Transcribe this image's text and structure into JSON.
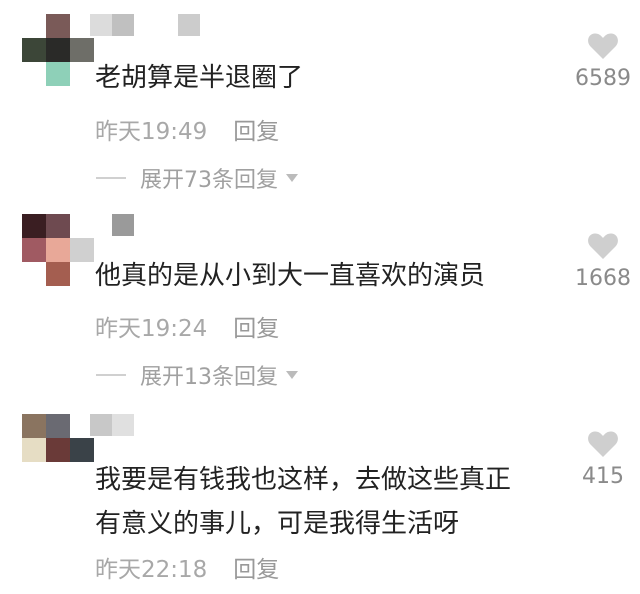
{
  "comments": [
    {
      "text_lines": [
        "老胡算是半退圈了"
      ],
      "time": "昨天19:49",
      "reply_label": "回复",
      "expand_label": "展开73条回复",
      "likes": "6589",
      "avatar_pixels": [
        "#ffffff",
        "#7a5a58",
        "#ffffff",
        "#ffffff",
        "#3c4638",
        "#2a2a28",
        "#6e6e68",
        "#ffffff",
        "#ffffff",
        "#8ed0b8",
        "#ffffff",
        "#ffffff"
      ],
      "name_pixels": [
        "#dcdcdc",
        "#c0c0c0",
        "#ffffff",
        "#ffffff",
        "#cccccc"
      ]
    },
    {
      "text_lines": [
        "他真的是从小到大一直喜欢的演员"
      ],
      "time": "昨天19:24",
      "reply_label": "回复",
      "expand_label": "展开13条回复",
      "likes": "1668",
      "avatar_pixels": [
        "#3a1e22",
        "#6e4a50",
        "#ffffff",
        "#ffffff",
        "#a05a62",
        "#e8a898",
        "#d0d0d0",
        "#ffffff",
        "#ffffff",
        "#a45e50",
        "#ffffff",
        "#ffffff"
      ],
      "name_pixels": [
        "#ffffff",
        "#9a9a9a",
        "#ffffff",
        "#ffffff",
        "#ffffff"
      ]
    },
    {
      "text_lines": [
        "我要是有钱我也这样，去做这些真正",
        "有意义的事儿，可是我得生活呀"
      ],
      "time": "昨天22:18",
      "reply_label": "回复",
      "likes": "415",
      "avatar_pixels": [
        "#8a7460",
        "#6a6a72",
        "#ffffff",
        "#ffffff",
        "#e6ddc4",
        "#6a3a38",
        "#3a4248",
        "#ffffff",
        "#ffffff",
        "#ffffff",
        "#ffffff",
        "#ffffff"
      ],
      "name_pixels": [
        "#c8c8c8",
        "#e0e0e0",
        "#ffffff",
        "#ffffff",
        "#ffffff"
      ]
    }
  ],
  "colors": {
    "like_icon": "#cfcfcf",
    "text": "#222222",
    "meta": "#a8a8a8"
  },
  "icons": {
    "like": "heart-icon",
    "expand": "chevron-down-icon"
  }
}
